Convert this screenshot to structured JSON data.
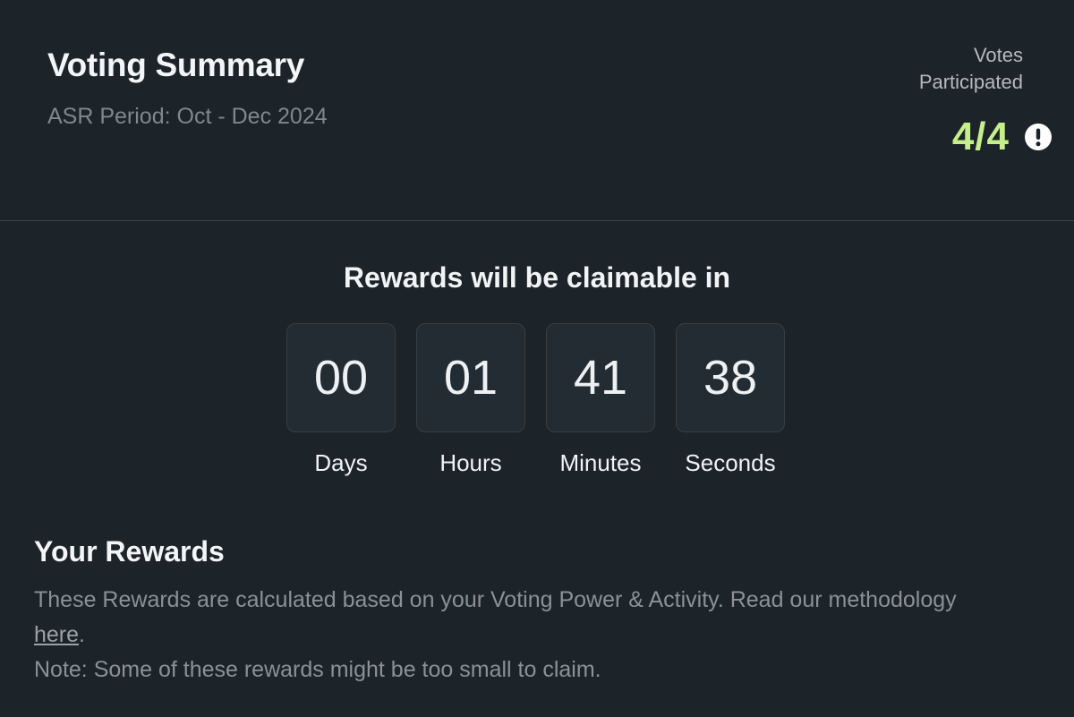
{
  "header": {
    "title": "Voting Summary",
    "period": "ASR Period: Oct - Dec 2024",
    "votes_label_line1": "Votes",
    "votes_label_line2": "Participated",
    "votes_value": "4/4",
    "alert_icon": "exclamation-circle-icon"
  },
  "countdown": {
    "heading": "Rewards will be claimable in",
    "units": [
      {
        "value": "00",
        "label": "Days"
      },
      {
        "value": "01",
        "label": "Hours"
      },
      {
        "value": "41",
        "label": "Minutes"
      },
      {
        "value": "38",
        "label": "Seconds"
      }
    ]
  },
  "rewards": {
    "title": "Your Rewards",
    "description": "These Rewards are calculated based on your Voting Power & Activity. Read our methodology",
    "link_text": "here",
    "description_end": ".",
    "note": "Note: Some of these rewards might be too small to claim."
  },
  "colors": {
    "background": "#1c2329",
    "accent_green": "#c6ee8a",
    "muted_text": "#8a9198",
    "box_bg": "#242c33"
  }
}
